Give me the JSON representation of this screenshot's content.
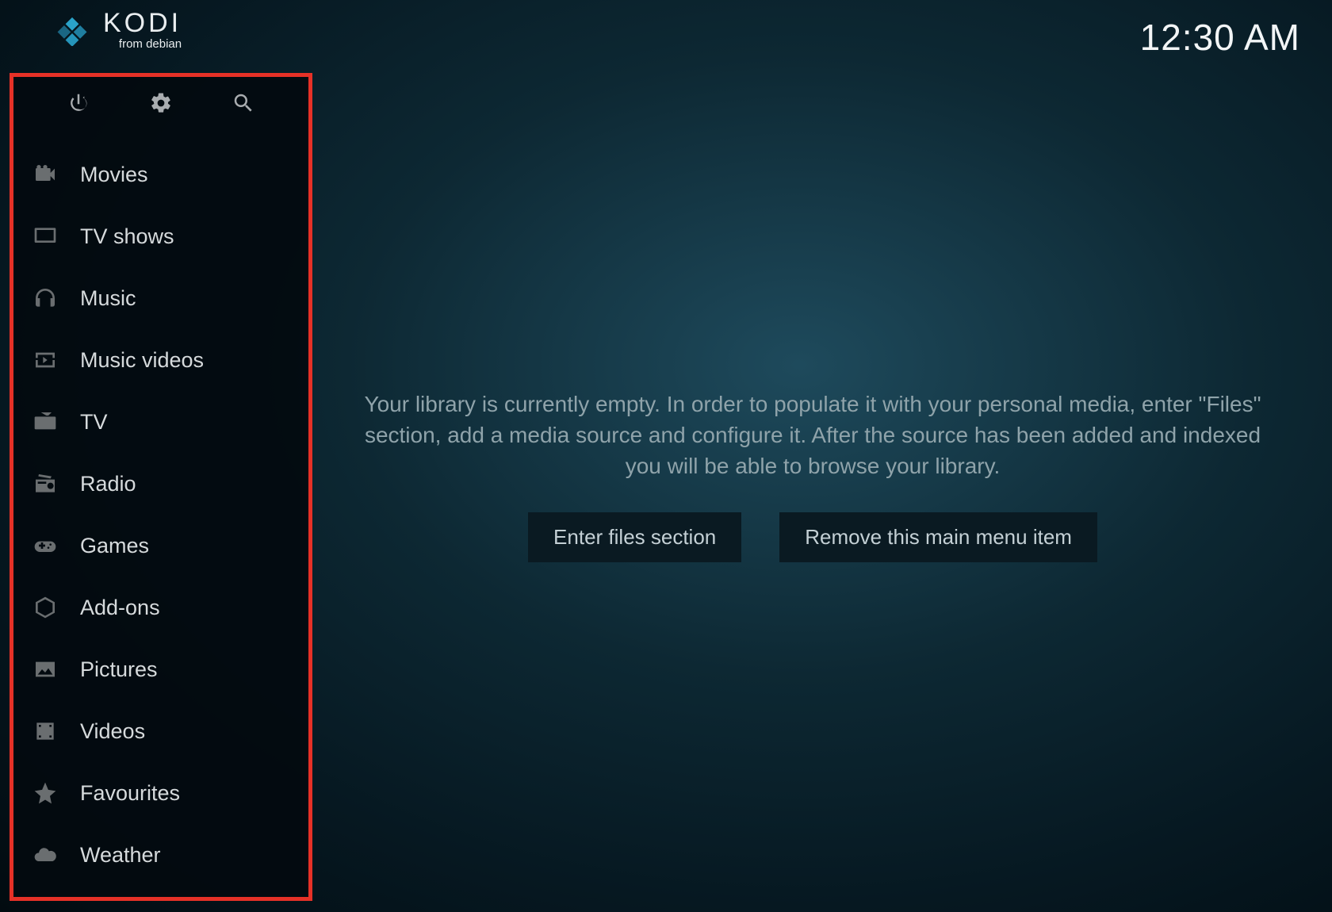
{
  "header": {
    "app_name": "KODI",
    "subtitle": "from debian",
    "clock": "12:30 AM"
  },
  "toolbar": {
    "power_icon": "power-icon",
    "settings_icon": "gear-icon",
    "search_icon": "search-icon"
  },
  "sidebar": {
    "items": [
      {
        "label": "Movies",
        "icon": "movie-camera-icon"
      },
      {
        "label": "TV shows",
        "icon": "tv-display-icon"
      },
      {
        "label": "Music",
        "icon": "headphones-icon"
      },
      {
        "label": "Music videos",
        "icon": "music-note-icon"
      },
      {
        "label": "TV",
        "icon": "tv-antenna-icon"
      },
      {
        "label": "Radio",
        "icon": "radio-icon"
      },
      {
        "label": "Games",
        "icon": "gamepad-icon"
      },
      {
        "label": "Add-ons",
        "icon": "box-icon"
      },
      {
        "label": "Pictures",
        "icon": "image-icon"
      },
      {
        "label": "Videos",
        "icon": "film-strip-icon"
      },
      {
        "label": "Favourites",
        "icon": "star-icon"
      },
      {
        "label": "Weather",
        "icon": "cloud-icon"
      }
    ]
  },
  "main": {
    "message": "Your library is currently empty. In order to populate it with your personal media, enter \"Files\" section, add a media source and configure it. After the source has been added and indexed you will be able to browse your library.",
    "enter_files_label": "Enter files section",
    "remove_item_label": "Remove this main menu item"
  }
}
